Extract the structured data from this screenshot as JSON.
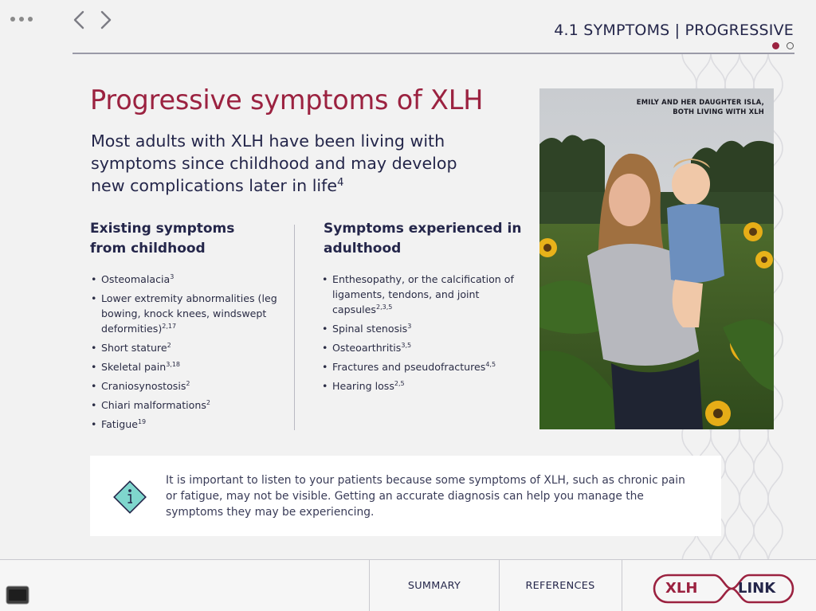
{
  "header": {
    "section_title": "4.1 SYMPTOMS | PROGRESSIVE",
    "more_icon": "more-dots-icon",
    "back_icon": "chevron-left-icon",
    "forward_icon": "chevron-right-icon"
  },
  "main": {
    "heading": "Progressive symptoms of XLH",
    "intro_text": "Most adults with XLH have been living with symptoms since childhood and may develop new complications later in life",
    "intro_ref": "4"
  },
  "columns": [
    {
      "heading": "Existing symptoms from childhood",
      "items": [
        {
          "text": "Osteomalacia",
          "ref": "3"
        },
        {
          "text": "Lower extremity abnormalities (leg bowing, knock knees, windswept deformities)",
          "ref": "2,17"
        },
        {
          "text": "Short stature",
          "ref": "2"
        },
        {
          "text": "Skeletal pain",
          "ref": "3,18"
        },
        {
          "text": "Craniosynostosis",
          "ref": "2"
        },
        {
          "text": "Chiari malformations",
          "ref": "2"
        },
        {
          "text": "Fatigue",
          "ref": "19"
        }
      ]
    },
    {
      "heading": "Symptoms experienced in adulthood",
      "items": [
        {
          "text": "Enthesopathy, or the calcification of ligaments, tendons, and joint capsules",
          "ref": "2,3,5"
        },
        {
          "text": "Spinal stenosis",
          "ref": "3"
        },
        {
          "text": "Osteoarthritis",
          "ref": "3,5"
        },
        {
          "text": "Fractures and pseudofractures",
          "ref": "4,5"
        },
        {
          "text": "Hearing loss",
          "ref": "2,5"
        }
      ]
    }
  ],
  "photo": {
    "caption_line1": "EMILY AND HER DAUGHTER ISLA,",
    "caption_line2": "BOTH LIVING WITH XLH"
  },
  "info_box": {
    "icon": "info-diamond-icon",
    "text": "It is important to listen to your patients because some symptoms of XLH, such as chronic pain or fatigue, may not be visible. Getting an accurate diagnosis can help you manage the symptoms they may be experiencing."
  },
  "footer": {
    "summary_label": "SUMMARY",
    "references_label": "REFERENCES",
    "logo_left": "XLH",
    "logo_right": "LINK",
    "camera_icon": "screen-icon"
  },
  "pagination": {
    "current": 1,
    "total": 2
  },
  "colors": {
    "accent": "#9b2240",
    "navy": "#24264a",
    "info_teal": "#7fd6cd"
  }
}
